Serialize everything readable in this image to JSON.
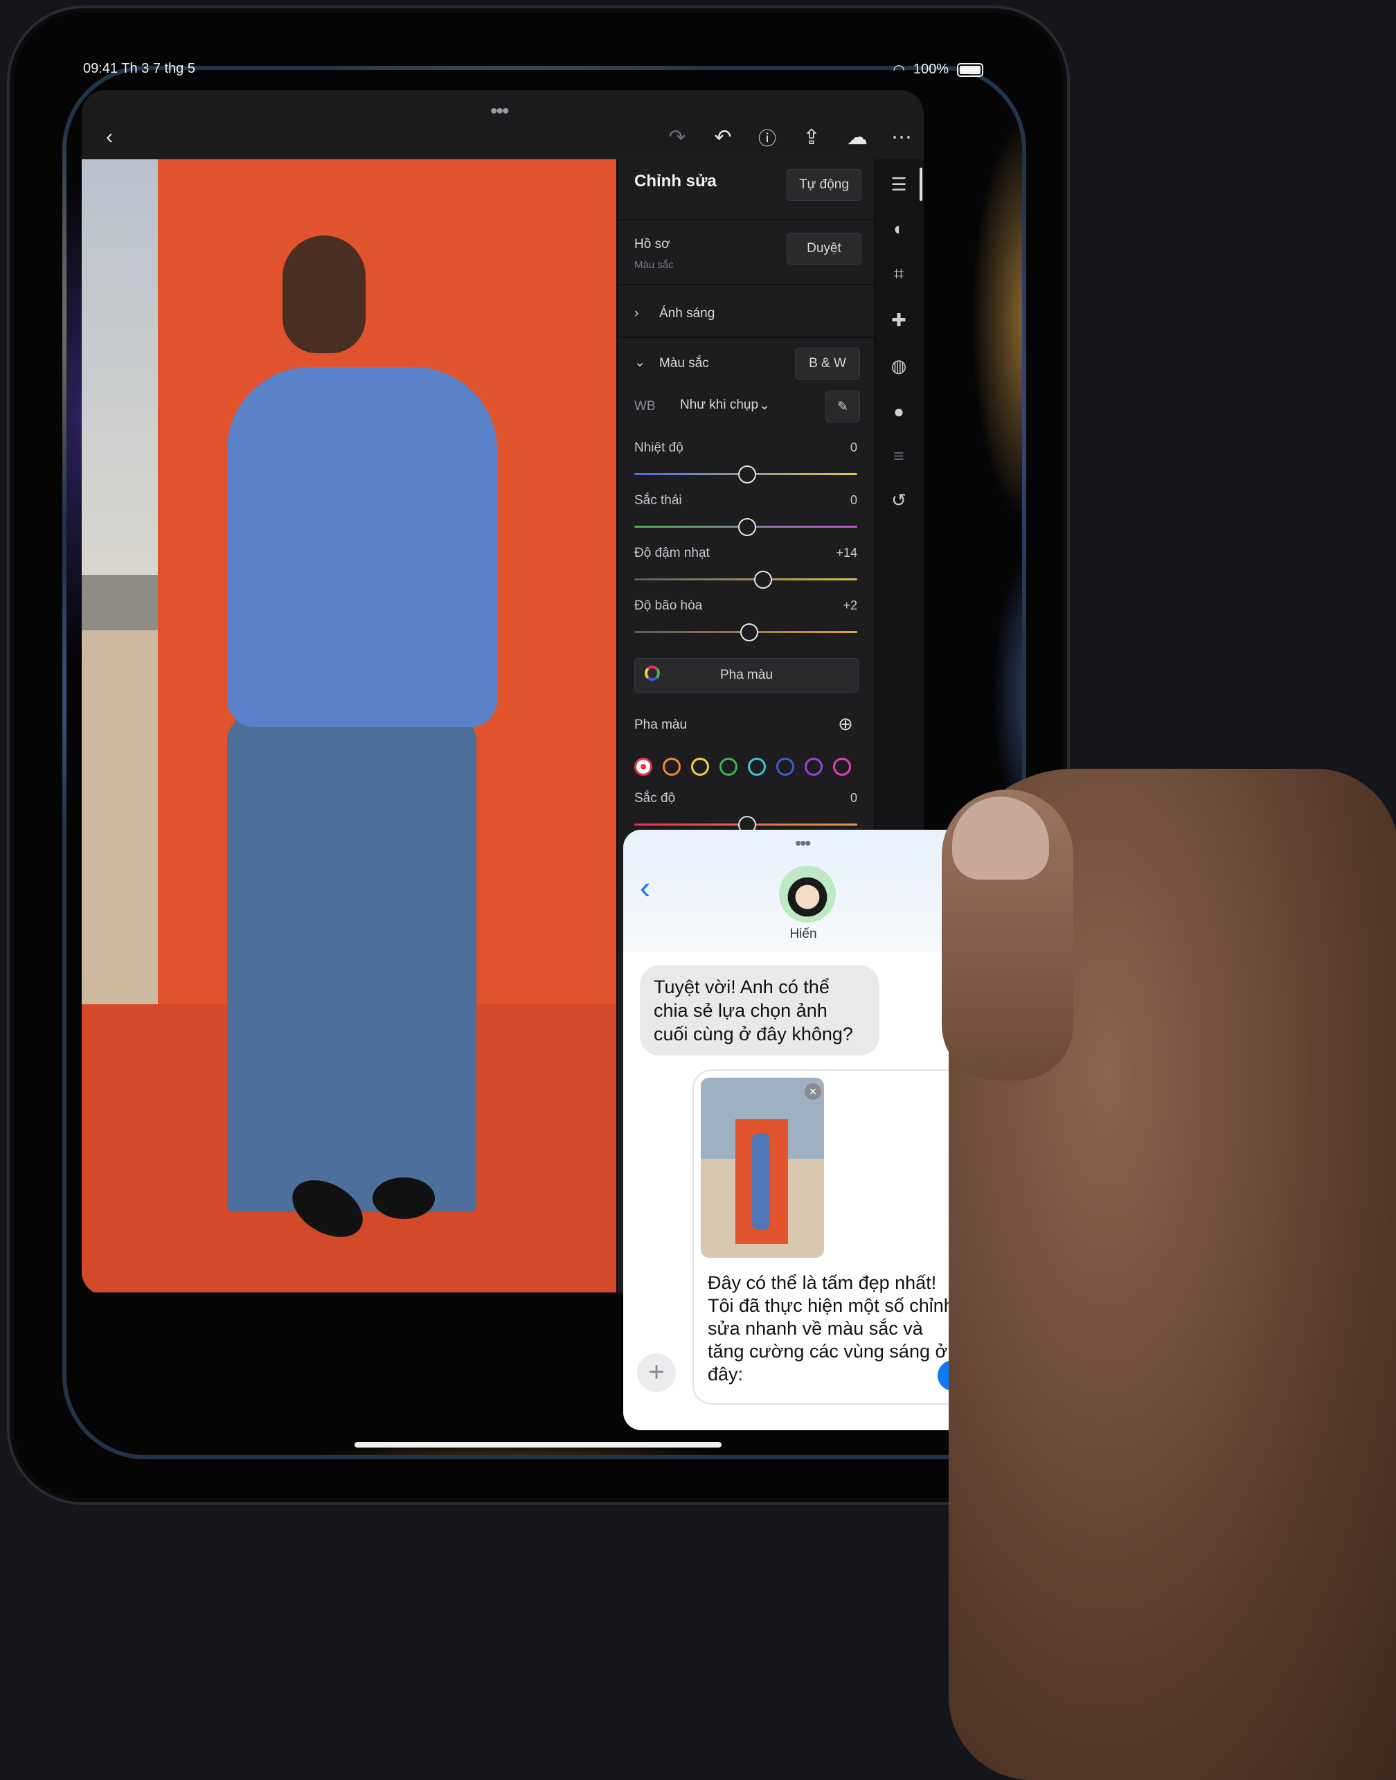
{
  "status_bar": {
    "time_date": "09:41  Th 3 7 thg 5",
    "battery": "100%"
  },
  "lightroom": {
    "toolbar_icons": [
      "back-icon",
      "redo-icon",
      "undo-icon",
      "help-icon",
      "share-icon",
      "cloud-sync-icon",
      "more-icon"
    ],
    "panel_title": "Chỉnh sửa",
    "auto_label": "Tự động",
    "profile_label": "Hồ sơ",
    "profile_sub": "Màu sắc",
    "browse_label": "Duyệt",
    "light_label": "Ánh sáng",
    "color_label": "Màu sắc",
    "bw_label": "B & W",
    "wb_label": "WB",
    "wb_value": "Như khi chụp",
    "sliders": [
      {
        "label": "Nhiệt độ",
        "value": "0",
        "position": 0.5
      },
      {
        "label": "Sắc thái",
        "value": "0",
        "position": 0.5
      },
      {
        "label": "Độ đậm nhạt",
        "value": "+14",
        "position": 0.57
      },
      {
        "label": "Độ bão hòa",
        "value": "+2",
        "position": 0.51
      }
    ],
    "color_mix_button": "Pha màu",
    "color_mix_label": "Pha màu",
    "swatch_colors": [
      "#e8344d",
      "#f08a2a",
      "#f2d23a",
      "#3fb34f",
      "#3ec6d8",
      "#3c5bd6",
      "#9a3fe0",
      "#e03fb9"
    ],
    "hue_label": "Sắc độ",
    "hue_value": "0",
    "hue_position": 0.5,
    "rail_icons": [
      "sliders-icon",
      "mask-icon",
      "crop-icon",
      "heal-icon",
      "blur-icon",
      "drop-icon",
      "presets-icon",
      "history-icon"
    ]
  },
  "messages": {
    "contact_name": "Hiến",
    "incoming": "Tuyệt vời! Anh có thể chia sẻ lựa chọn ảnh cuối cùng ở đây không?",
    "draft_text": "Đây có thể là tấm đẹp nhất! Tôi đã thực hiện một số chỉnh sửa nhanh về màu sắc và tăng cường các vùng sáng ở đây:"
  }
}
